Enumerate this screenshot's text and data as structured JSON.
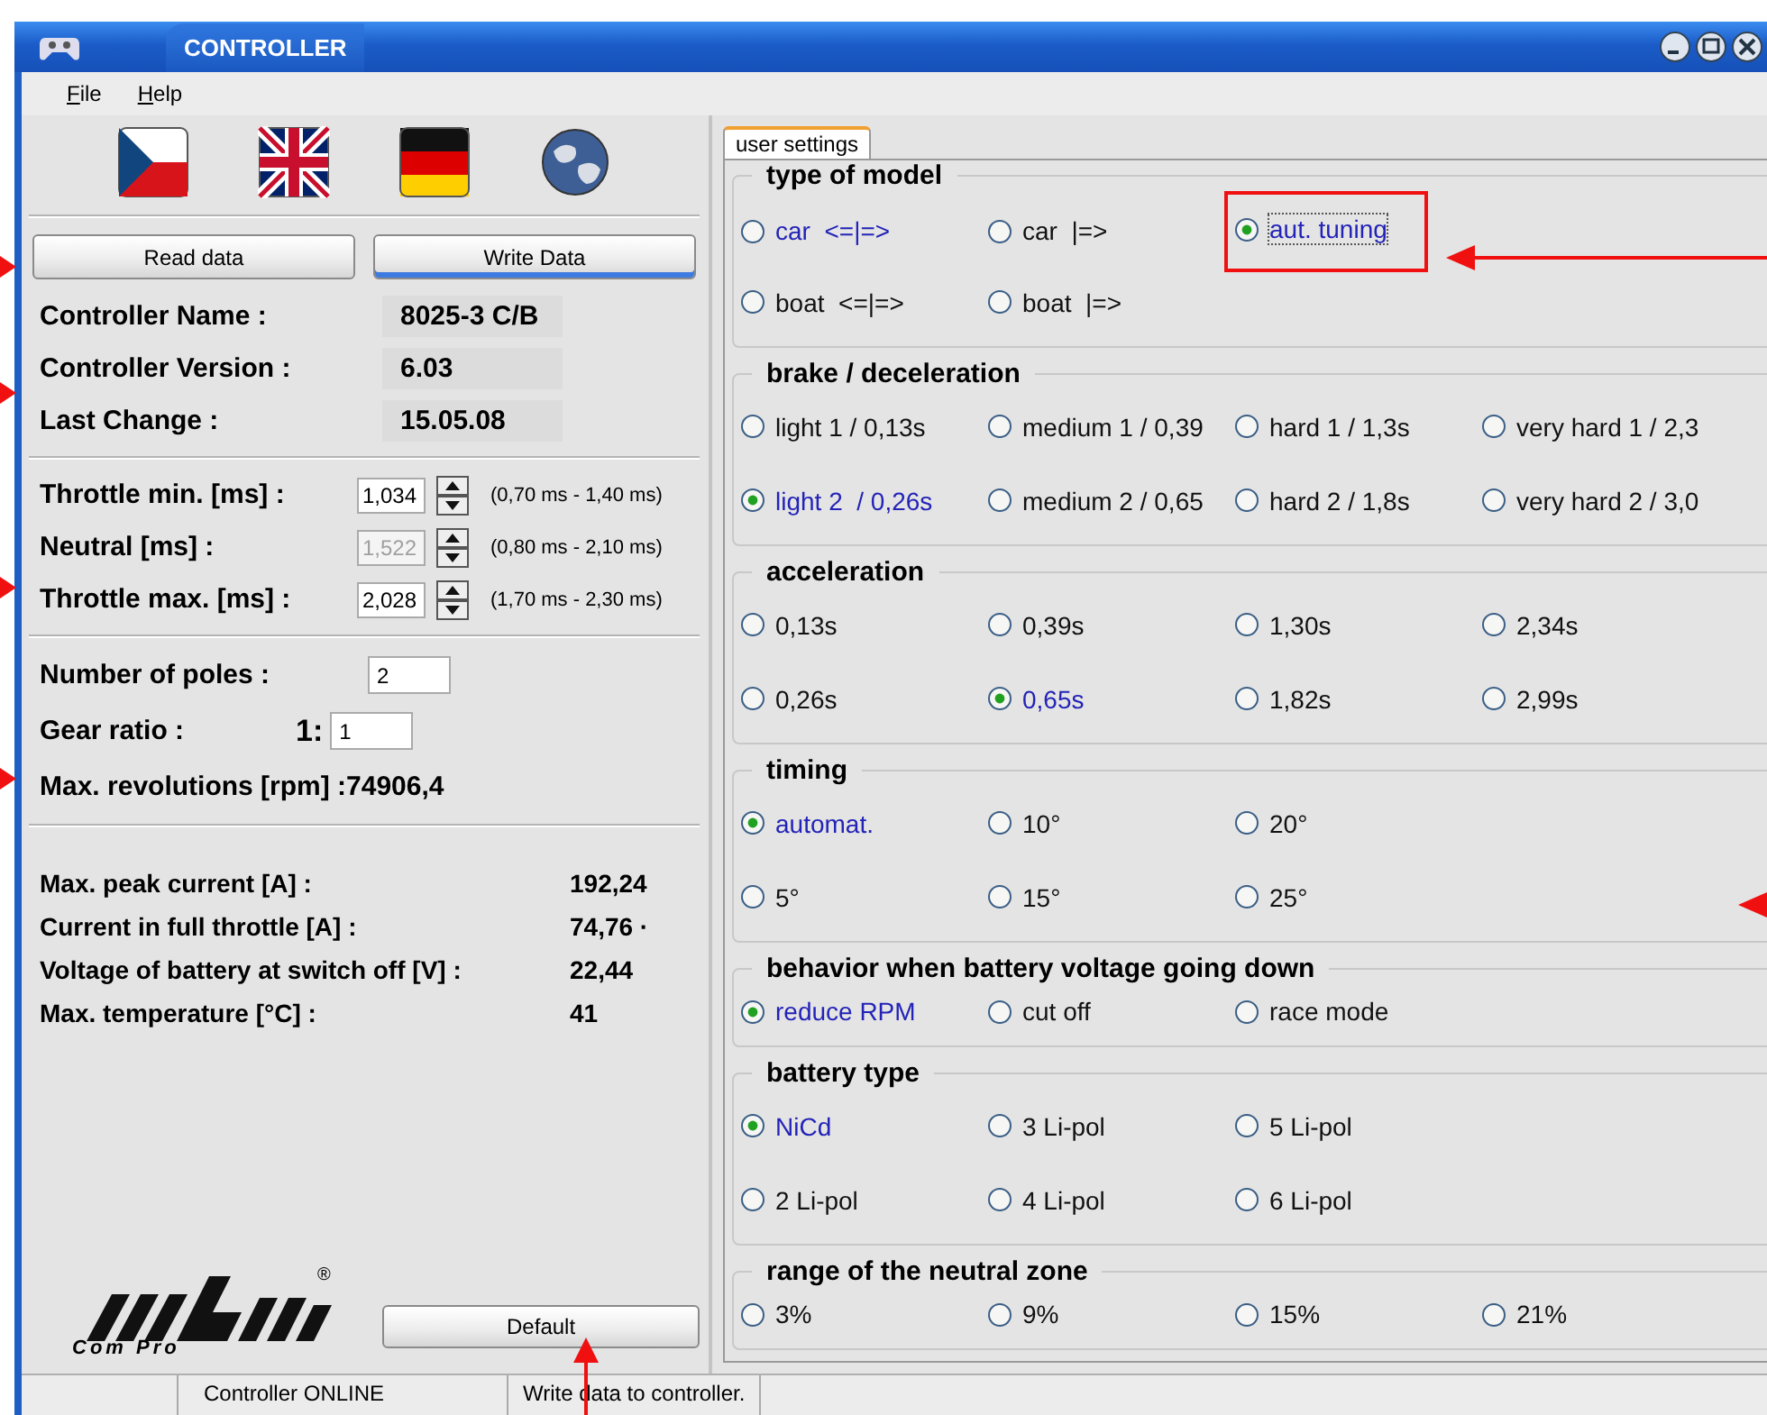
{
  "window": {
    "title": "CONTROLLER"
  },
  "menu": [
    {
      "label": "File"
    },
    {
      "label": "Help"
    }
  ],
  "data_buttons": [
    {
      "label": "Read data",
      "default": false
    },
    {
      "label": "Write Data",
      "default": true
    }
  ],
  "info": [
    {
      "label": "Controller Name :",
      "value": "8025-3 C/B"
    },
    {
      "label": "Controller Version :",
      "value": "6.03"
    },
    {
      "label": "Last Change :",
      "value": "15.05.08"
    }
  ],
  "pulses": [
    {
      "label": "Throttle min. [ms] :",
      "value": "1,034",
      "disabled": false,
      "range": "(0,70 ms - 1,40 ms)"
    },
    {
      "label": "Neutral [ms] :",
      "value": "1,522",
      "disabled": true,
      "range": "(0,80 ms - 2,10 ms)"
    },
    {
      "label": "Throttle max. [ms] :",
      "value": "2,028",
      "disabled": false,
      "range": "(1,70 ms - 2,30 ms)"
    }
  ],
  "poles": {
    "label": "Number of poles :",
    "value": "2"
  },
  "gear": {
    "label": "Gear ratio :",
    "prefix": "1:",
    "value": "1"
  },
  "max_revolutions": "Max. revolutions [rpm] :74906,4",
  "stats": [
    {
      "label": "Max. peak current [A] :",
      "value": "192,24"
    },
    {
      "label": "Current in full throttle [A] :",
      "value": "74,76 ·"
    },
    {
      "label": "Voltage of battery at switch off [V] :",
      "value": "22,44"
    },
    {
      "label": "Max. temperature [°C] :",
      "value": "41"
    }
  ],
  "logo": {
    "caption": "Com Pro",
    "mark": "®"
  },
  "default_button": "Default",
  "tabs": [
    {
      "label": "user settings",
      "selected": true
    }
  ],
  "groups": [
    {
      "title": "type of model",
      "rows": [
        [
          {
            "label": "car  <=|=>",
            "selected": false,
            "hover": true
          },
          {
            "label": "car  |=>",
            "selected": false
          },
          {
            "label": "aut. tuning",
            "selected": true,
            "focused": true,
            "annotated": true
          }
        ],
        [
          {
            "label": "boat  <=|=>",
            "selected": false
          },
          {
            "label": "boat  |=>",
            "selected": false
          }
        ]
      ]
    },
    {
      "title": "brake / deceleration",
      "rows": [
        [
          {
            "label": "light 1 / 0,13s",
            "selected": false
          },
          {
            "label": "medium 1 / 0,39",
            "selected": false
          },
          {
            "label": "hard 1 / 1,3s",
            "selected": false
          },
          {
            "label": "very hard 1 / 2,3",
            "selected": false
          }
        ],
        [
          {
            "label": "light 2  / 0,26s",
            "selected": true
          },
          {
            "label": "medium 2 / 0,65",
            "selected": false
          },
          {
            "label": "hard 2 / 1,8s",
            "selected": false
          },
          {
            "label": "very hard 2 / 3,0",
            "selected": false
          }
        ]
      ]
    },
    {
      "title": "acceleration",
      "rows": [
        [
          {
            "label": "0,13s",
            "selected": false
          },
          {
            "label": "0,39s",
            "selected": false
          },
          {
            "label": "1,30s",
            "selected": false
          },
          {
            "label": "2,34s",
            "selected": false
          }
        ],
        [
          {
            "label": "0,26s",
            "selected": false
          },
          {
            "label": "0,65s",
            "selected": true
          },
          {
            "label": "1,82s",
            "selected": false
          },
          {
            "label": "2,99s",
            "selected": false
          }
        ]
      ]
    },
    {
      "title": "timing",
      "rows": [
        [
          {
            "label": "automat.",
            "selected": true
          },
          {
            "label": "10°",
            "selected": false
          },
          {
            "label": "20°",
            "selected": false
          }
        ],
        [
          {
            "label": "5°",
            "selected": false
          },
          {
            "label": "15°",
            "selected": false
          },
          {
            "label": "25°",
            "selected": false
          }
        ]
      ]
    },
    {
      "title": "behavior when battery voltage going down",
      "rows": [
        [
          {
            "label": "reduce RPM",
            "selected": true
          },
          {
            "label": "cut off",
            "selected": false
          },
          {
            "label": "race mode",
            "selected": false
          }
        ]
      ]
    },
    {
      "title": "battery type",
      "rows": [
        [
          {
            "label": "NiCd",
            "selected": true
          },
          {
            "label": "3 Li-pol",
            "selected": false
          },
          {
            "label": "5 Li-pol",
            "selected": false
          }
        ],
        [
          {
            "label": "2 Li-pol",
            "selected": false
          },
          {
            "label": "4 Li-pol",
            "selected": false
          },
          {
            "label": "6 Li-pol",
            "selected": false
          }
        ]
      ]
    },
    {
      "title": "range of the neutral zone",
      "rows": [
        [
          {
            "label": "3%",
            "selected": false
          },
          {
            "label": "9%",
            "selected": false
          },
          {
            "label": "15%",
            "selected": false
          },
          {
            "label": "21%",
            "selected": false
          }
        ]
      ]
    }
  ],
  "status_bar": [
    "Controller ONLINE",
    "Write data to controller."
  ]
}
